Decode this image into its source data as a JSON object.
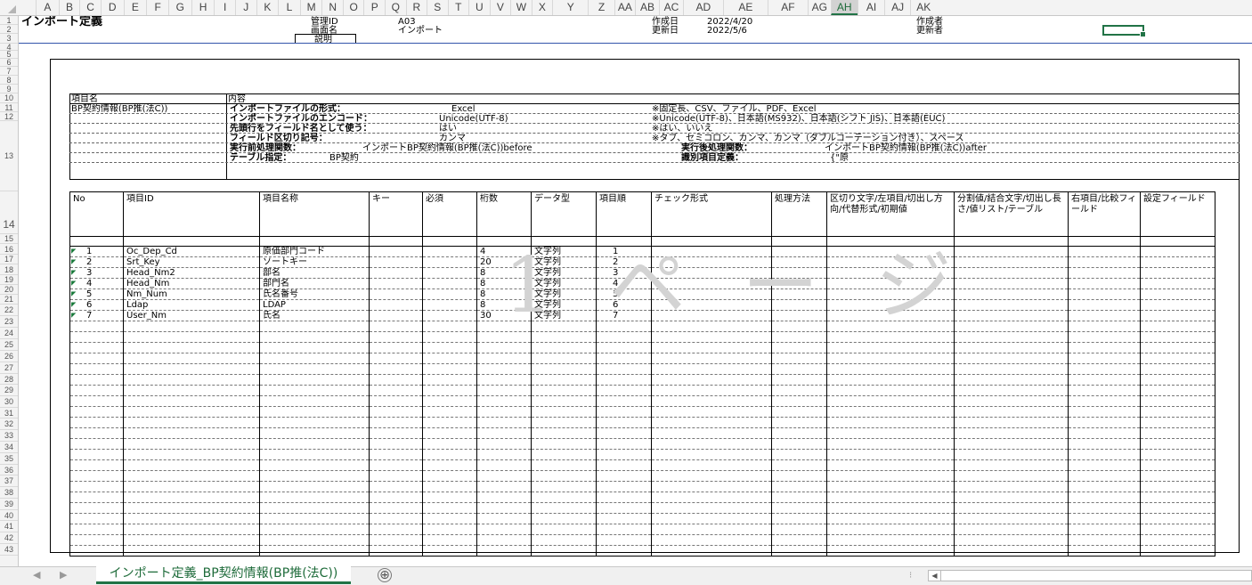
{
  "columns": [
    "A",
    "B",
    "C",
    "D",
    "E",
    "F",
    "G",
    "H",
    "I",
    "J",
    "K",
    "L",
    "M",
    "N",
    "O",
    "P",
    "Q",
    "R",
    "S",
    "T",
    "U",
    "V",
    "W",
    "X",
    "Y",
    "Z",
    "AA",
    "AB",
    "AC",
    "AD",
    "AE",
    "AF",
    "AG",
    "AH",
    "AI",
    "AJ",
    "AK"
  ],
  "selected_column": "AH",
  "rows": [
    "1",
    "2",
    "3",
    "4",
    "5",
    "6",
    "7",
    "8",
    "9",
    "10",
    "11",
    "12",
    "13",
    "14",
    "15",
    "16",
    "17",
    "18",
    "19",
    "20",
    "21",
    "22",
    "23",
    "24",
    "25",
    "26",
    "27",
    "28",
    "29",
    "30",
    "31",
    "32",
    "33",
    "34",
    "35",
    "36",
    "37",
    "38",
    "39",
    "40",
    "41",
    "42",
    "43"
  ],
  "header": {
    "title": "インポート定義",
    "id_label": "管理ID",
    "id_value": "A03",
    "screen_label": "画面名",
    "screen_value": "インポート",
    "desc_label": "説明",
    "created_label": "作成日",
    "created_value": "2022/4/20",
    "updated_label": "更新日",
    "updated_value": "2022/5/6",
    "author_label": "作成者",
    "updater_label": "更新者"
  },
  "info": {
    "item_header": "項目名",
    "content_header": "内容",
    "item_name": "BP契約情報(BP推(法C))",
    "format_label": "インポートファイルの形式：",
    "format_value": "Excel",
    "format_note": "※固定長、CSV、ファイル、PDF、Excel",
    "encoding_label": "インポートファイルのエンコード：",
    "encoding_value": "Unicode(UTF-8)",
    "encoding_note": "※Unicode(UTF-8)、日本語(MS932)、日本語(シフト JIS)、日本語(EUC)",
    "firstrow_label": "先頭行をフィールド名として使う：",
    "firstrow_value": "はい",
    "firstrow_note": "※はい、いいえ",
    "delimiter_label": "フィールド区切り記号：",
    "delimiter_value": "カンマ",
    "delimiter_note": "※タブ、セミコロン、カンマ、カンマ（ダブルコーテーション付き）、スペース",
    "pre_label": "実行前処理関数：",
    "pre_value": "インポートBP契約情報(BP推(法C))before",
    "post_label": "実行後処理関数：",
    "post_value": "インポートBP契約情報(BP推(法C))after",
    "table_label": "テーブル指定：",
    "table_value": "BP契約",
    "ident_label": "識別項目定義：",
    "ident_value": "{\"原"
  },
  "table": {
    "headers": [
      "No",
      "項目ID",
      "項目名称",
      "キー",
      "必須",
      "桁数",
      "データ型",
      "項目順",
      "チェック形式",
      "処理方法",
      "区切り文字/左項目/切出し方向/代替形式/初期値",
      "分割値/結合文字/切出し長さ/値リスト/テーブル",
      "右項目/比較フィールド",
      "設定フィールド"
    ],
    "rows": [
      {
        "no": "1",
        "id": "Oc_Dep_Cd",
        "name": "原価部門コード",
        "digits": "4",
        "type": "文字列",
        "order": "1"
      },
      {
        "no": "2",
        "id": "Srt_Key",
        "name": "ソートキー",
        "digits": "20",
        "type": "文字列",
        "order": "2"
      },
      {
        "no": "3",
        "id": "Head_Nm2",
        "name": "部名",
        "digits": "8",
        "type": "文字列",
        "order": "3"
      },
      {
        "no": "4",
        "id": "Head_Nm",
        "name": "部門名",
        "digits": "8",
        "type": "文字列",
        "order": "4"
      },
      {
        "no": "5",
        "id": "Nm_Num",
        "name": "氏名番号",
        "digits": "8",
        "type": "文字列",
        "order": "5"
      },
      {
        "no": "6",
        "id": "Ldap",
        "name": "LDAP",
        "digits": "8",
        "type": "文字列",
        "order": "6"
      },
      {
        "no": "7",
        "id": "User_Nm",
        "name": "氏名",
        "digits": "30",
        "type": "文字列",
        "order": "7"
      }
    ]
  },
  "watermark": "1 ペ ー ジ",
  "sheet_tab": "インポート定義_BP契約情報(BP推(法C))",
  "add_sheet": "⊕"
}
